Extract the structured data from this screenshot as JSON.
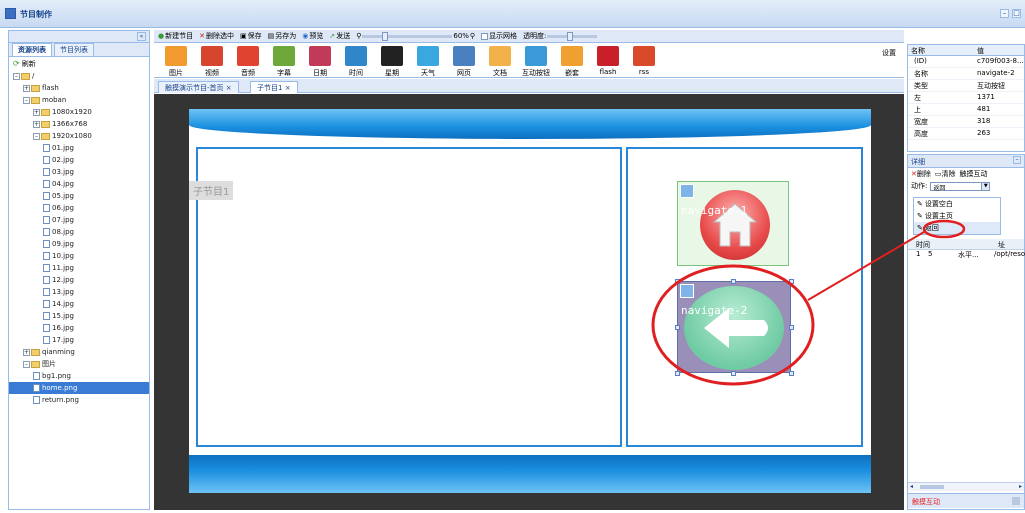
{
  "titlebar": {
    "title": "节目制作"
  },
  "left": {
    "tabs": [
      "资源列表",
      "节目列表"
    ],
    "refresh": "刷新",
    "tree": [
      {
        "label": "/",
        "type": "folder",
        "expanded": true,
        "depth": 0
      },
      {
        "label": "flash",
        "type": "folder",
        "expanded": false,
        "depth": 1
      },
      {
        "label": "moban",
        "type": "folder",
        "expanded": true,
        "depth": 1
      },
      {
        "label": "1080x1920",
        "type": "folder",
        "expanded": false,
        "depth": 2
      },
      {
        "label": "1366x768",
        "type": "folder",
        "expanded": false,
        "depth": 2
      },
      {
        "label": "1920x1080",
        "type": "folder",
        "expanded": true,
        "depth": 2
      },
      {
        "label": "01.jpg",
        "type": "file",
        "depth": 3
      },
      {
        "label": "02.jpg",
        "type": "file",
        "depth": 3
      },
      {
        "label": "03.jpg",
        "type": "file",
        "depth": 3
      },
      {
        "label": "04.jpg",
        "type": "file",
        "depth": 3
      },
      {
        "label": "05.jpg",
        "type": "file",
        "depth": 3
      },
      {
        "label": "06.jpg",
        "type": "file",
        "depth": 3
      },
      {
        "label": "07.jpg",
        "type": "file",
        "depth": 3
      },
      {
        "label": "08.jpg",
        "type": "file",
        "depth": 3
      },
      {
        "label": "09.jpg",
        "type": "file",
        "depth": 3
      },
      {
        "label": "10.jpg",
        "type": "file",
        "depth": 3
      },
      {
        "label": "11.jpg",
        "type": "file",
        "depth": 3
      },
      {
        "label": "12.jpg",
        "type": "file",
        "depth": 3
      },
      {
        "label": "13.jpg",
        "type": "file",
        "depth": 3
      },
      {
        "label": "14.jpg",
        "type": "file",
        "depth": 3
      },
      {
        "label": "15.jpg",
        "type": "file",
        "depth": 3
      },
      {
        "label": "16.jpg",
        "type": "file",
        "depth": 3
      },
      {
        "label": "17.jpg",
        "type": "file",
        "depth": 3
      },
      {
        "label": "qianming",
        "type": "folder",
        "expanded": false,
        "depth": 1
      },
      {
        "label": "图片",
        "type": "folder",
        "expanded": true,
        "depth": 1
      },
      {
        "label": "bg1.png",
        "type": "file",
        "depth": 2
      },
      {
        "label": "home.png",
        "type": "file",
        "depth": 2,
        "selected": true
      },
      {
        "label": "return.png",
        "type": "file",
        "depth": 2
      }
    ]
  },
  "toolbar": {
    "new_program": "新建节目",
    "delete_selected": "删除选中",
    "save": "保存",
    "save_as": "另存为",
    "preview": "预览",
    "send": "发送",
    "zoom": "60%",
    "show_grid": "显示网格",
    "opacity_label": "透明度:"
  },
  "palette": {
    "items": [
      {
        "label": "图片",
        "color": "#f29a2e"
      },
      {
        "label": "视频",
        "color": "#d8452f"
      },
      {
        "label": "音频",
        "color": "#e0432f"
      },
      {
        "label": "字幕",
        "color": "#6fa83a"
      },
      {
        "label": "日期",
        "color": "#c23a5a"
      },
      {
        "label": "时间",
        "color": "#2f86c8"
      },
      {
        "label": "星期",
        "color": "#222222"
      },
      {
        "label": "天气",
        "color": "#3aa8e0"
      },
      {
        "label": "网页",
        "color": "#4a7fc0"
      },
      {
        "label": "文档",
        "color": "#f2b14a"
      },
      {
        "label": "互动按钮",
        "color": "#3a9ad8"
      },
      {
        "label": "嵌套",
        "color": "#f0a030"
      },
      {
        "label": "flash",
        "color": "#c8202a"
      },
      {
        "label": "rss",
        "color": "#d84a2a"
      }
    ],
    "settings": "设置"
  },
  "doctabs": [
    "触摸演示节目-首页",
    "子节目1"
  ],
  "canvas": {
    "node_label": "子节目1",
    "nav1_text": "navigate-1",
    "nav2_text": "navigate-2"
  },
  "props": {
    "header": [
      "名称",
      "值"
    ],
    "rows": [
      {
        "k": "(ID)",
        "v": "c709f003-8..."
      },
      {
        "k": "名称",
        "v": "navigate-2"
      },
      {
        "k": "类型",
        "v": "互动按钮"
      },
      {
        "k": "左",
        "v": "1371"
      },
      {
        "k": "上",
        "v": "481"
      },
      {
        "k": "宽度",
        "v": "318"
      },
      {
        "k": "高度",
        "v": "263"
      }
    ]
  },
  "detail": {
    "title": "详细",
    "delete": "删除",
    "clear": "清除",
    "touch_interact": "触摸互动",
    "action_label": "动作:",
    "action_value": "返回",
    "options": [
      "设置空白",
      "设置主页",
      "返回"
    ],
    "grid_headers": [
      "时间",
      "址"
    ],
    "grid_row": {
      "idx": "1",
      "col1": "5",
      "col2": "水平...",
      "col3": "/opt/resou..."
    },
    "footer": "触摸互动"
  }
}
